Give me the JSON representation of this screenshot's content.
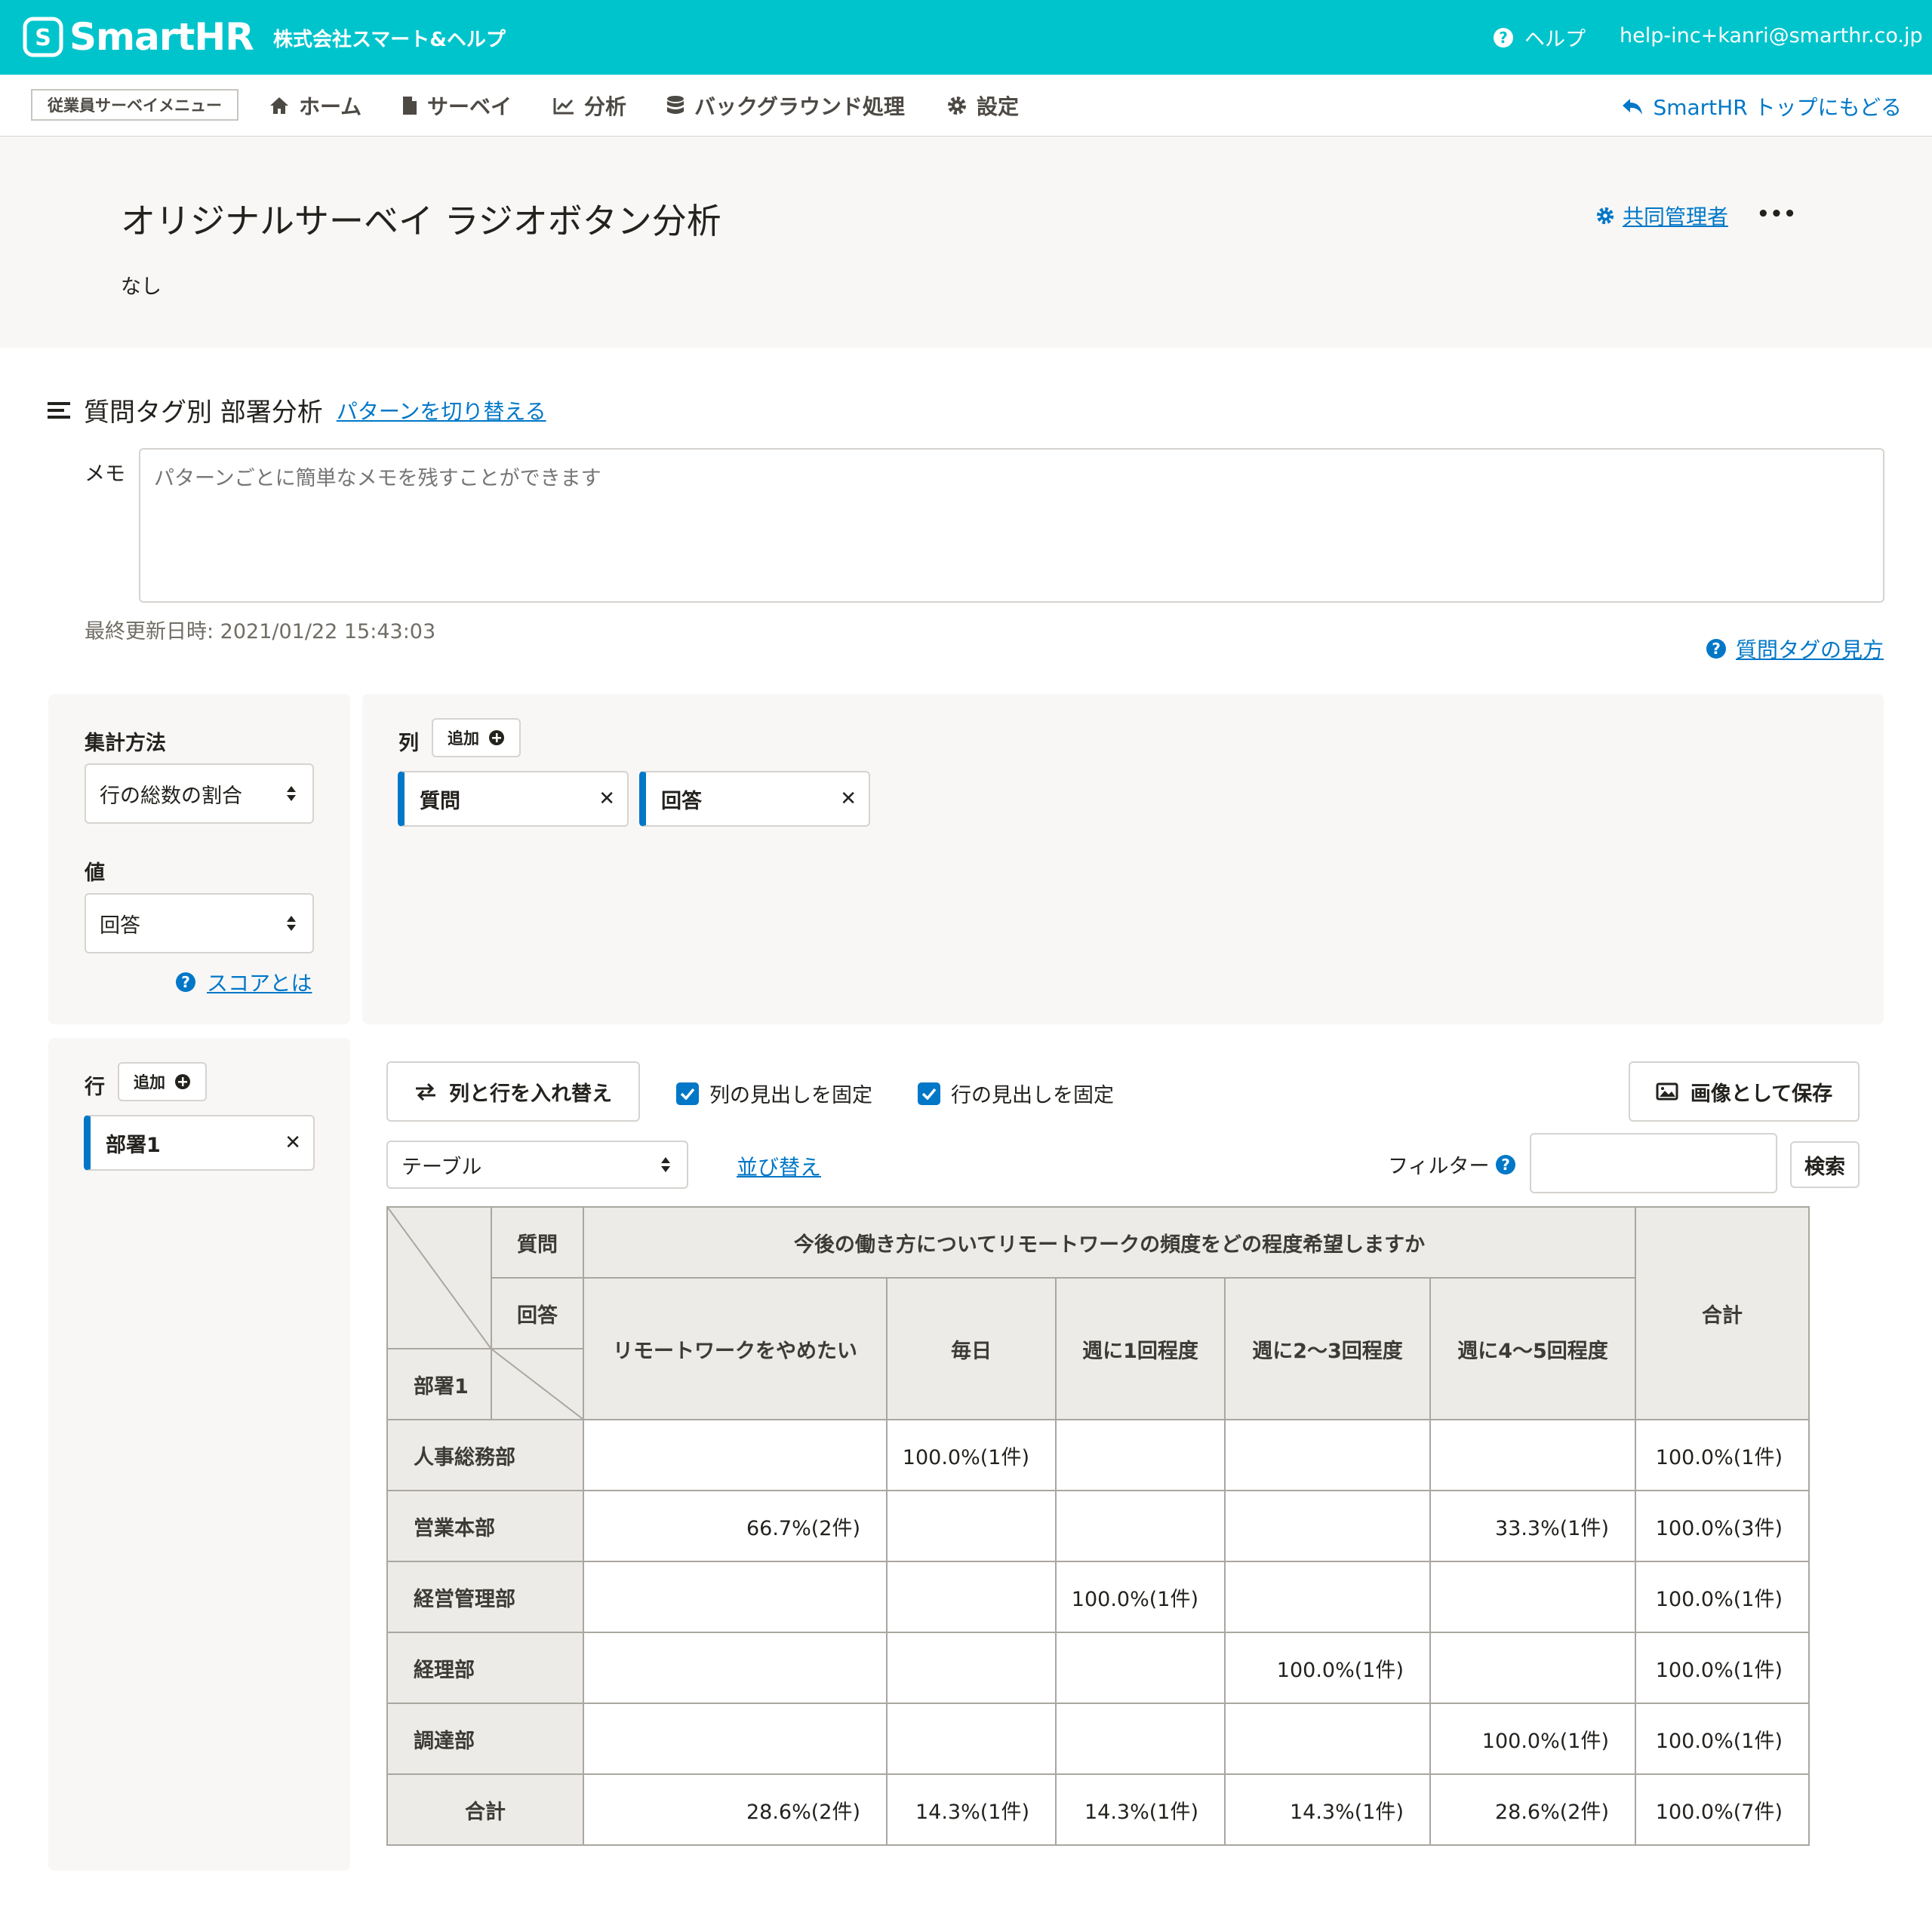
{
  "topbar": {
    "brand": "SmartHR",
    "company": "株式会社スマート&ヘルプ",
    "help_label": "ヘルプ",
    "email": "help-inc+kanri@smarthr.co.jp",
    "color": "#00c4cc"
  },
  "nav": {
    "menu_label": "従業員サーベイメニュー",
    "items": [
      "ホーム",
      "サーベイ",
      "分析",
      "バックグラウンド処理",
      "設定"
    ],
    "back_label": "SmartHR トップにもどる"
  },
  "header": {
    "title": "オリジナルサーベイ ラジオボタン分析",
    "description": "なし",
    "coadmin_label": "共同管理者",
    "more_label": "•••"
  },
  "section": {
    "title": "質問タグ別 部署分析",
    "switch_pattern_label": "パターンを切り替える",
    "memo_label": "メモ",
    "memo_placeholder": "パターンごとに簡単なメモを残すことができます",
    "updated": "最終更新日時: 2021/01/22 15:43:03",
    "tag_guide_label": "質問タグの見方"
  },
  "settings": {
    "aggregation_label": "集計方法",
    "aggregation_value": "行の総数の割合",
    "value_label": "値",
    "value_value": "回答",
    "score_help_label": "スコアとは",
    "columns_label": "列",
    "add_label": "追加",
    "column_chips": [
      "質問",
      "回答"
    ],
    "rows_label": "行",
    "row_chips": [
      "部署1"
    ]
  },
  "toolbar": {
    "swap_label": "列と行を入れ替え",
    "fix_col_header_label": "列の見出しを固定",
    "fix_row_header_label": "行の見出しを固定",
    "save_image_label": "画像として保存",
    "view_select": "テーブル",
    "sort_label": "並び替え",
    "filter_label": "フィルター",
    "search_label": "検索"
  },
  "table": {
    "question_header": "質問",
    "answer_header": "回答",
    "row_header": "部署1",
    "question_text": "今後の働き方についてリモートワークの頻度をどの程度希望しますか",
    "answers": [
      "リモートワークをやめたい",
      "毎日",
      "週に1回程度",
      "週に2〜3回程度",
      "週に4〜5回程度"
    ],
    "total_header": "合計",
    "rows": [
      {
        "name": "人事総務部",
        "cells": [
          "",
          "100.0%(1件)",
          "",
          "",
          "",
          "100.0%(1件)"
        ]
      },
      {
        "name": "営業本部",
        "cells": [
          "66.7%(2件)",
          "",
          "",
          "",
          "33.3%(1件)",
          "100.0%(3件)"
        ]
      },
      {
        "name": "経営管理部",
        "cells": [
          "",
          "",
          "100.0%(1件)",
          "",
          "",
          "100.0%(1件)"
        ]
      },
      {
        "name": "経理部",
        "cells": [
          "",
          "",
          "",
          "100.0%(1件)",
          "",
          "100.0%(1件)"
        ]
      },
      {
        "name": "調達部",
        "cells": [
          "",
          "",
          "",
          "",
          "100.0%(1件)",
          "100.0%(1件)"
        ]
      },
      {
        "name": "合計",
        "cells": [
          "28.6%(2件)",
          "14.3%(1件)",
          "14.3%(1件)",
          "14.3%(1件)",
          "28.6%(2件)",
          "100.0%(7件)"
        ]
      }
    ]
  }
}
